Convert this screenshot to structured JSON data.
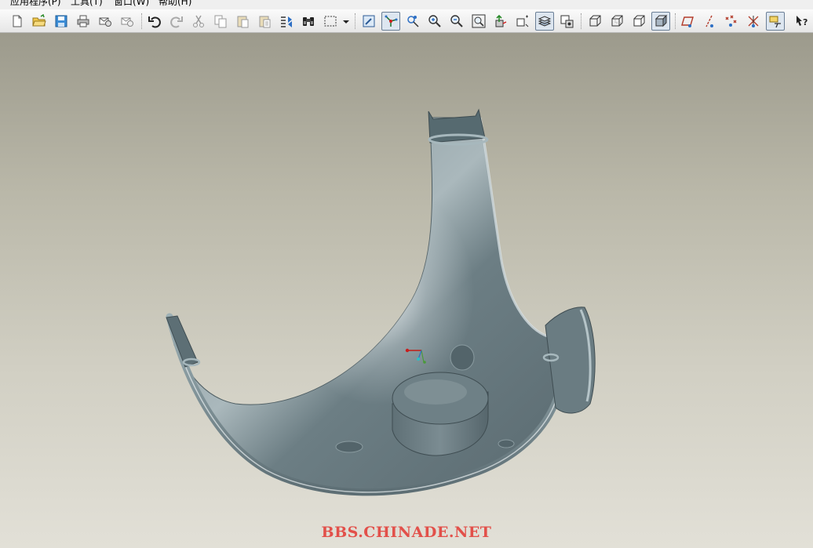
{
  "menubar": {
    "items": [
      {
        "label": "应用程序(P)"
      },
      {
        "label": "工具(T)"
      },
      {
        "label": "窗口(W)"
      },
      {
        "label": "帮助(H)"
      }
    ]
  },
  "toolbar": {
    "icons": [
      "new-file-icon",
      "open-folder-icon",
      "save-icon",
      "print-icon",
      "mail-icon",
      "mail-send-icon",
      "undo-icon",
      "redo-icon",
      "cut-icon",
      "copy-icon",
      "paste-icon",
      "paste-special-icon",
      "regenerate-icon",
      "find-icon",
      "selection-box-icon",
      "dropdown-arrow-icon",
      "repaint-icon",
      "spin-center-icon",
      "orient-mode-icon",
      "zoom-in-icon",
      "zoom-out-icon",
      "refit-icon",
      "reorient-icon",
      "saved-views-icon",
      "layers-icon",
      "view-manager-icon",
      "wireframe-icon",
      "hidden-line-icon",
      "no-hidden-icon",
      "shading-icon",
      "datum-planes-icon",
      "datum-axes-icon",
      "datum-points-icon",
      "coordinate-systems-icon",
      "annotations-icon",
      "context-help-icon"
    ],
    "accent_color": "#6b7f96"
  },
  "viewport": {
    "background_top": "#9c9a8c",
    "background_bottom": "#e2e0d7",
    "model_color": "#6f8389"
  },
  "watermark": {
    "text": "BBS.CHINADE.NET",
    "color": "#e2504a"
  }
}
